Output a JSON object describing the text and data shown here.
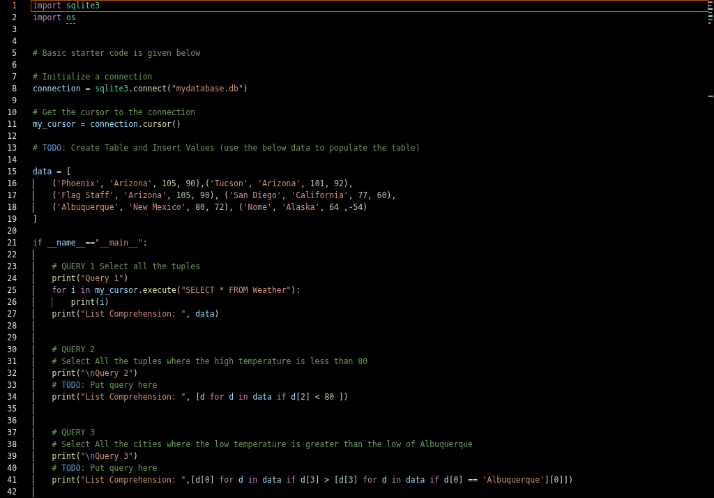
{
  "lines": [
    {
      "kind": "line",
      "number": "1",
      "current": true,
      "tokens": [
        {
          "kind": "kw",
          "text": "import "
        },
        {
          "kind": "mod",
          "text": "sqlite3"
        }
      ]
    },
    {
      "kind": "line",
      "number": "2",
      "current": false,
      "tokens": [
        {
          "kind": "kw",
          "text": "import "
        },
        {
          "kind": "unused",
          "text": "os"
        }
      ]
    },
    {
      "kind": "line",
      "number": "3",
      "current": false
    },
    {
      "kind": "line",
      "number": "4",
      "current": false
    },
    {
      "kind": "line",
      "number": "5",
      "current": false,
      "tokens": [
        {
          "kind": "com",
          "text": "# Basic starter code is given below"
        }
      ]
    },
    {
      "kind": "line",
      "number": "6",
      "current": false
    },
    {
      "kind": "line",
      "number": "7",
      "current": false,
      "tokens": [
        {
          "kind": "com",
          "text": "# Initialize a connection"
        }
      ]
    },
    {
      "kind": "line",
      "number": "8",
      "current": false,
      "tokens": [
        {
          "kind": "var",
          "text": "connection"
        },
        {
          "kind": "plain",
          "text": " = "
        },
        {
          "kind": "mod",
          "text": "sqlite3"
        },
        {
          "kind": "plain",
          "text": "."
        },
        {
          "kind": "fn",
          "text": "connect"
        },
        {
          "kind": "plain",
          "text": "("
        },
        {
          "kind": "str",
          "text": "\"mydatabase.db\""
        },
        {
          "kind": "plain",
          "text": ")"
        }
      ]
    },
    {
      "kind": "line",
      "number": "9",
      "current": false
    },
    {
      "kind": "line",
      "number": "10",
      "current": false,
      "tokens": [
        {
          "kind": "com",
          "text": "# Get the cursor to the connection"
        }
      ]
    },
    {
      "kind": "line",
      "number": "11",
      "current": false,
      "tokens": [
        {
          "kind": "var",
          "text": "my_cursor"
        },
        {
          "kind": "plain",
          "text": " = "
        },
        {
          "kind": "var",
          "text": "connection"
        },
        {
          "kind": "plain",
          "text": "."
        },
        {
          "kind": "fn",
          "text": "cursor"
        },
        {
          "kind": "plain",
          "text": "()"
        }
      ]
    },
    {
      "kind": "line",
      "number": "12",
      "current": false
    },
    {
      "kind": "line",
      "number": "13",
      "current": false,
      "tokens": [
        {
          "kind": "com",
          "text": "# "
        },
        {
          "kind": "todo",
          "text": "TODO"
        },
        {
          "kind": "com",
          "text": ": Create Table and Insert Values (use the below data to populate the table)"
        }
      ]
    },
    {
      "kind": "line",
      "number": "14",
      "current": false
    },
    {
      "kind": "line",
      "number": "15",
      "current": false,
      "tokens": [
        {
          "kind": "var",
          "text": "data"
        },
        {
          "kind": "plain",
          "text": " = ["
        }
      ]
    },
    {
      "kind": "block",
      "active": true,
      "children": [
        {
          "kind": "line",
          "number": "16",
          "current": false,
          "tokens": [
            {
              "kind": "plain",
              "text": "("
            },
            {
              "kind": "str",
              "text": "'Phoenix'"
            },
            {
              "kind": "plain",
              "text": ", "
            },
            {
              "kind": "str",
              "text": "'Arizona'"
            },
            {
              "kind": "plain",
              "text": ", "
            },
            {
              "kind": "num",
              "text": "105"
            },
            {
              "kind": "plain",
              "text": ", "
            },
            {
              "kind": "num",
              "text": "90"
            },
            {
              "kind": "plain",
              "text": "),("
            },
            {
              "kind": "str",
              "text": "'Tucson'"
            },
            {
              "kind": "plain",
              "text": ", "
            },
            {
              "kind": "str",
              "text": "'Arizona'"
            },
            {
              "kind": "plain",
              "text": ", "
            },
            {
              "kind": "num",
              "text": "101"
            },
            {
              "kind": "plain",
              "text": ", "
            },
            {
              "kind": "num",
              "text": "92"
            },
            {
              "kind": "plain",
              "text": "),"
            }
          ]
        },
        {
          "kind": "line",
          "number": "17",
          "current": false,
          "tokens": [
            {
              "kind": "plain",
              "text": "("
            },
            {
              "kind": "str",
              "text": "'Flag Staff'"
            },
            {
              "kind": "plain",
              "text": ", "
            },
            {
              "kind": "str",
              "text": "'Arizona'"
            },
            {
              "kind": "plain",
              "text": ", "
            },
            {
              "kind": "num",
              "text": "105"
            },
            {
              "kind": "plain",
              "text": ", "
            },
            {
              "kind": "num",
              "text": "90"
            },
            {
              "kind": "plain",
              "text": "), ("
            },
            {
              "kind": "str",
              "text": "'San Diego'"
            },
            {
              "kind": "plain",
              "text": ", "
            },
            {
              "kind": "str",
              "text": "'California'"
            },
            {
              "kind": "plain",
              "text": ", "
            },
            {
              "kind": "num",
              "text": "77"
            },
            {
              "kind": "plain",
              "text": ", "
            },
            {
              "kind": "num",
              "text": "60"
            },
            {
              "kind": "plain",
              "text": "),"
            }
          ]
        },
        {
          "kind": "line",
          "number": "18",
          "current": false,
          "tokens": [
            {
              "kind": "plain",
              "text": "("
            },
            {
              "kind": "str",
              "text": "'Albuquerque'"
            },
            {
              "kind": "plain",
              "text": ", "
            },
            {
              "kind": "str",
              "text": "'New Mexico'"
            },
            {
              "kind": "plain",
              "text": ", "
            },
            {
              "kind": "num",
              "text": "80"
            },
            {
              "kind": "plain",
              "text": ", "
            },
            {
              "kind": "num",
              "text": "72"
            },
            {
              "kind": "plain",
              "text": "), ("
            },
            {
              "kind": "str",
              "text": "'Nome'"
            },
            {
              "kind": "plain",
              "text": ", "
            },
            {
              "kind": "str",
              "text": "'Alaska'"
            },
            {
              "kind": "plain",
              "text": ", "
            },
            {
              "kind": "num",
              "text": "64"
            },
            {
              "kind": "plain",
              "text": " ,"
            },
            {
              "kind": "num",
              "text": "-54"
            },
            {
              "kind": "plain",
              "text": ")"
            }
          ]
        }
      ]
    },
    {
      "kind": "line",
      "number": "19",
      "current": false,
      "tokens": [
        {
          "kind": "plain",
          "text": "]"
        }
      ]
    },
    {
      "kind": "line",
      "number": "20",
      "current": false
    },
    {
      "kind": "line",
      "number": "21",
      "current": false,
      "tokens": [
        {
          "kind": "kw",
          "text": "if "
        },
        {
          "kind": "var",
          "text": "__name__"
        },
        {
          "kind": "plain",
          "text": "=="
        },
        {
          "kind": "str",
          "text": "\"__main__\""
        },
        {
          "kind": "plain",
          "text": ":"
        }
      ]
    },
    {
      "kind": "block",
      "active": true,
      "children": [
        {
          "kind": "line",
          "number": "22",
          "current": false
        },
        {
          "kind": "line",
          "number": "23",
          "current": false,
          "tokens": [
            {
              "kind": "com",
              "text": "# QUERY 1 Select all the tuples"
            }
          ]
        },
        {
          "kind": "line",
          "number": "24",
          "current": false,
          "tokens": [
            {
              "kind": "fn",
              "text": "print"
            },
            {
              "kind": "plain",
              "text": "("
            },
            {
              "kind": "str",
              "text": "\"Query 1\""
            },
            {
              "kind": "plain",
              "text": ")"
            }
          ]
        },
        {
          "kind": "line",
          "number": "25",
          "current": false,
          "tokens": [
            {
              "kind": "kw",
              "text": "for "
            },
            {
              "kind": "var",
              "text": "i "
            },
            {
              "kind": "kw",
              "text": "in "
            },
            {
              "kind": "var",
              "text": "my_cursor"
            },
            {
              "kind": "plain",
              "text": "."
            },
            {
              "kind": "fn",
              "text": "execute"
            },
            {
              "kind": "plain",
              "text": "("
            },
            {
              "kind": "str",
              "text": "\"SELECT * FROM Weather\""
            },
            {
              "kind": "plain",
              "text": "):"
            }
          ]
        },
        {
          "kind": "block",
          "active": false,
          "children": [
            {
              "kind": "line",
              "number": "26",
              "current": false,
              "tokens": [
                {
                  "kind": "fn",
                  "text": "print"
                },
                {
                  "kind": "plain",
                  "text": "("
                },
                {
                  "kind": "var",
                  "text": "i"
                },
                {
                  "kind": "plain",
                  "text": ")"
                }
              ]
            }
          ]
        },
        {
          "kind": "line",
          "number": "27",
          "current": false,
          "tokens": [
            {
              "kind": "fn",
              "text": "print"
            },
            {
              "kind": "plain",
              "text": "("
            },
            {
              "kind": "str",
              "text": "\"List Comprehension: \""
            },
            {
              "kind": "plain",
              "text": ", "
            },
            {
              "kind": "var",
              "text": "data"
            },
            {
              "kind": "plain",
              "text": ")"
            }
          ]
        },
        {
          "kind": "line",
          "number": "28",
          "current": false
        },
        {
          "kind": "line",
          "number": "29",
          "current": false
        },
        {
          "kind": "line",
          "number": "30",
          "current": false,
          "tokens": [
            {
              "kind": "com",
              "text": "# QUERY 2"
            }
          ]
        },
        {
          "kind": "line",
          "number": "31",
          "current": false,
          "tokens": [
            {
              "kind": "com",
              "text": "# Select All the tuples where the high temperature is less than 80"
            }
          ]
        },
        {
          "kind": "line",
          "number": "32",
          "current": false,
          "tokens": [
            {
              "kind": "fn",
              "text": "print"
            },
            {
              "kind": "plain",
              "text": "("
            },
            {
              "kind": "str",
              "text": "\""
            },
            {
              "kind": "esc",
              "text": "\\n"
            },
            {
              "kind": "str",
              "text": "Query 2\""
            },
            {
              "kind": "plain",
              "text": ")"
            }
          ]
        },
        {
          "kind": "line",
          "number": "33",
          "current": false,
          "tokens": [
            {
              "kind": "com",
              "text": "# "
            },
            {
              "kind": "todo",
              "text": "TODO"
            },
            {
              "kind": "com",
              "text": ": Put query here"
            }
          ]
        },
        {
          "kind": "line",
          "number": "34",
          "current": false,
          "tokens": [
            {
              "kind": "fn",
              "text": "print"
            },
            {
              "kind": "plain",
              "text": "("
            },
            {
              "kind": "str",
              "text": "\"List Comprehension: \""
            },
            {
              "kind": "plain",
              "text": ", ["
            },
            {
              "kind": "var",
              "text": "d "
            },
            {
              "kind": "kw",
              "text": "for "
            },
            {
              "kind": "var",
              "text": "d "
            },
            {
              "kind": "kw",
              "text": "in "
            },
            {
              "kind": "var",
              "text": "data "
            },
            {
              "kind": "kw",
              "text": "if "
            },
            {
              "kind": "var",
              "text": "d"
            },
            {
              "kind": "plain",
              "text": "["
            },
            {
              "kind": "num",
              "text": "2"
            },
            {
              "kind": "plain",
              "text": "] < "
            },
            {
              "kind": "num",
              "text": "80"
            },
            {
              "kind": "plain",
              "text": " ])"
            }
          ]
        },
        {
          "kind": "line",
          "number": "35",
          "current": false
        },
        {
          "kind": "line",
          "number": "36",
          "current": false
        },
        {
          "kind": "line",
          "number": "37",
          "current": false,
          "tokens": [
            {
              "kind": "com",
              "text": "# QUERY 3"
            }
          ]
        },
        {
          "kind": "line",
          "number": "38",
          "current": false,
          "tokens": [
            {
              "kind": "com",
              "text": "# Select All the cities where the low temperature is greater than the low of Albuquerque"
            }
          ]
        },
        {
          "kind": "line",
          "number": "39",
          "current": false,
          "tokens": [
            {
              "kind": "fn",
              "text": "print"
            },
            {
              "kind": "plain",
              "text": "("
            },
            {
              "kind": "str",
              "text": "\""
            },
            {
              "kind": "esc",
              "text": "\\n"
            },
            {
              "kind": "str",
              "text": "Query 3\""
            },
            {
              "kind": "plain",
              "text": ")"
            }
          ]
        },
        {
          "kind": "line",
          "number": "40",
          "current": false,
          "tokens": [
            {
              "kind": "com",
              "text": "# "
            },
            {
              "kind": "todo",
              "text": "TODO"
            },
            {
              "kind": "com",
              "text": ": Put query here"
            }
          ]
        },
        {
          "kind": "line",
          "number": "41",
          "current": false,
          "tokens": [
            {
              "kind": "fn",
              "text": "print"
            },
            {
              "kind": "plain",
              "text": "("
            },
            {
              "kind": "str",
              "text": "\"List Comprehension: \""
            },
            {
              "kind": "plain",
              "text": ",["
            },
            {
              "kind": "var",
              "text": "d"
            },
            {
              "kind": "plain",
              "text": "["
            },
            {
              "kind": "num",
              "text": "0"
            },
            {
              "kind": "plain",
              "text": "] "
            },
            {
              "kind": "kw",
              "text": "for "
            },
            {
              "kind": "var",
              "text": "d "
            },
            {
              "kind": "kw",
              "text": "in "
            },
            {
              "kind": "var",
              "text": "data "
            },
            {
              "kind": "kw",
              "text": "if "
            },
            {
              "kind": "var",
              "text": "d"
            },
            {
              "kind": "plain",
              "text": "["
            },
            {
              "kind": "num",
              "text": "3"
            },
            {
              "kind": "plain",
              "text": "] > ["
            },
            {
              "kind": "var",
              "text": "d"
            },
            {
              "kind": "plain",
              "text": "["
            },
            {
              "kind": "num",
              "text": "3"
            },
            {
              "kind": "plain",
              "text": "] "
            },
            {
              "kind": "kw",
              "text": "for "
            },
            {
              "kind": "var",
              "text": "d "
            },
            {
              "kind": "kw",
              "text": "in "
            },
            {
              "kind": "var",
              "text": "data "
            },
            {
              "kind": "kw",
              "text": "if "
            },
            {
              "kind": "var",
              "text": "d"
            },
            {
              "kind": "plain",
              "text": "["
            },
            {
              "kind": "num",
              "text": "0"
            },
            {
              "kind": "plain",
              "text": "] == "
            },
            {
              "kind": "str",
              "text": "'Albuquerque'"
            },
            {
              "kind": "plain",
              "text": "]["
            },
            {
              "kind": "num",
              "text": "0"
            },
            {
              "kind": "plain",
              "text": "]])"
            }
          ]
        },
        {
          "kind": "line",
          "number": "42",
          "current": false
        }
      ]
    }
  ]
}
